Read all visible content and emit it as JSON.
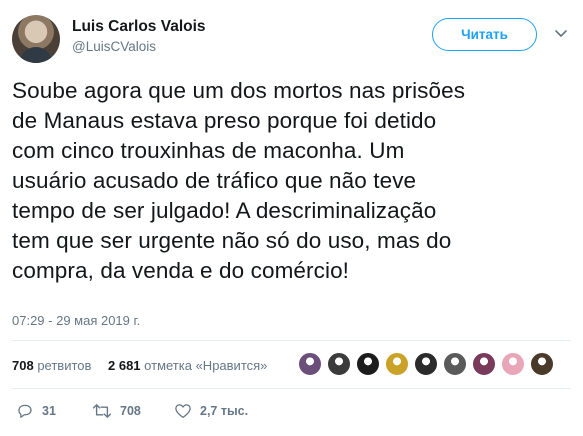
{
  "user": {
    "name": "Luis Carlos Valois",
    "handle": "@LuisCValois"
  },
  "follow_label": "Читать",
  "tweet": {
    "text": "Soube agora que um dos mortos nas prisões\nde Manaus estava preso porque foi detido\ncom cinco trouxinhas de maconha. Um\nusuário acusado de tráfico que não teve\ntempo de ser julgado! A descriminalização\ntem que ser urgente não só do uso, mas do\ncompra, da venda e do comércio!",
    "timestamp": "07:29 - 29 мая 2019 г."
  },
  "stats": {
    "retweets_count": "708",
    "retweets_label": "ретвитов",
    "likes_count": "2 681",
    "likes_label": "отметка «Нравится»"
  },
  "liker_avatar_colors": [
    "#6b4f7a",
    "#3b3b3b",
    "#1c1c1c",
    "#c9a227",
    "#2b2b2b",
    "#5a5a5a",
    "#7a3b5a",
    "#e8a6b8",
    "#4a3a2a"
  ],
  "actions": {
    "replies": "31",
    "retweets": "708",
    "likes": "2,7 тыс."
  },
  "colors": {
    "accent": "#1da1f2",
    "text": "#14171a",
    "muted": "#657786",
    "divider": "#e6ecf0"
  }
}
